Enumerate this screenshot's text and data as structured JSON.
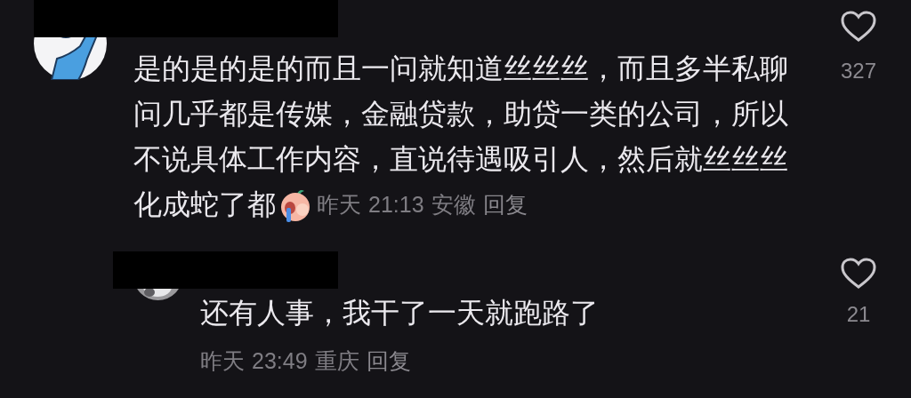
{
  "comments": [
    {
      "kind": "comment",
      "lines": [
        "是的是的是的而且一问就知道丝丝丝，而且多半私聊",
        "问几乎都是传媒，金融贷款，助贷一类的公司，所以",
        "不说具体工作内容，直说待遇吸引人，然后就丝丝丝",
        "化成蛇了都"
      ],
      "has_emoji": true,
      "date": "昨天",
      "time": "21:13",
      "location": "安徽",
      "reply_label": "回复",
      "liked": false,
      "like_count": "327"
    },
    {
      "kind": "reply",
      "lines": [
        "还有人事，我干了一天就跑路了"
      ],
      "has_emoji": false,
      "date": "昨天",
      "time": "23:49",
      "location": "重庆",
      "reply_label": "回复",
      "liked": false,
      "like_count": "21"
    }
  ]
}
